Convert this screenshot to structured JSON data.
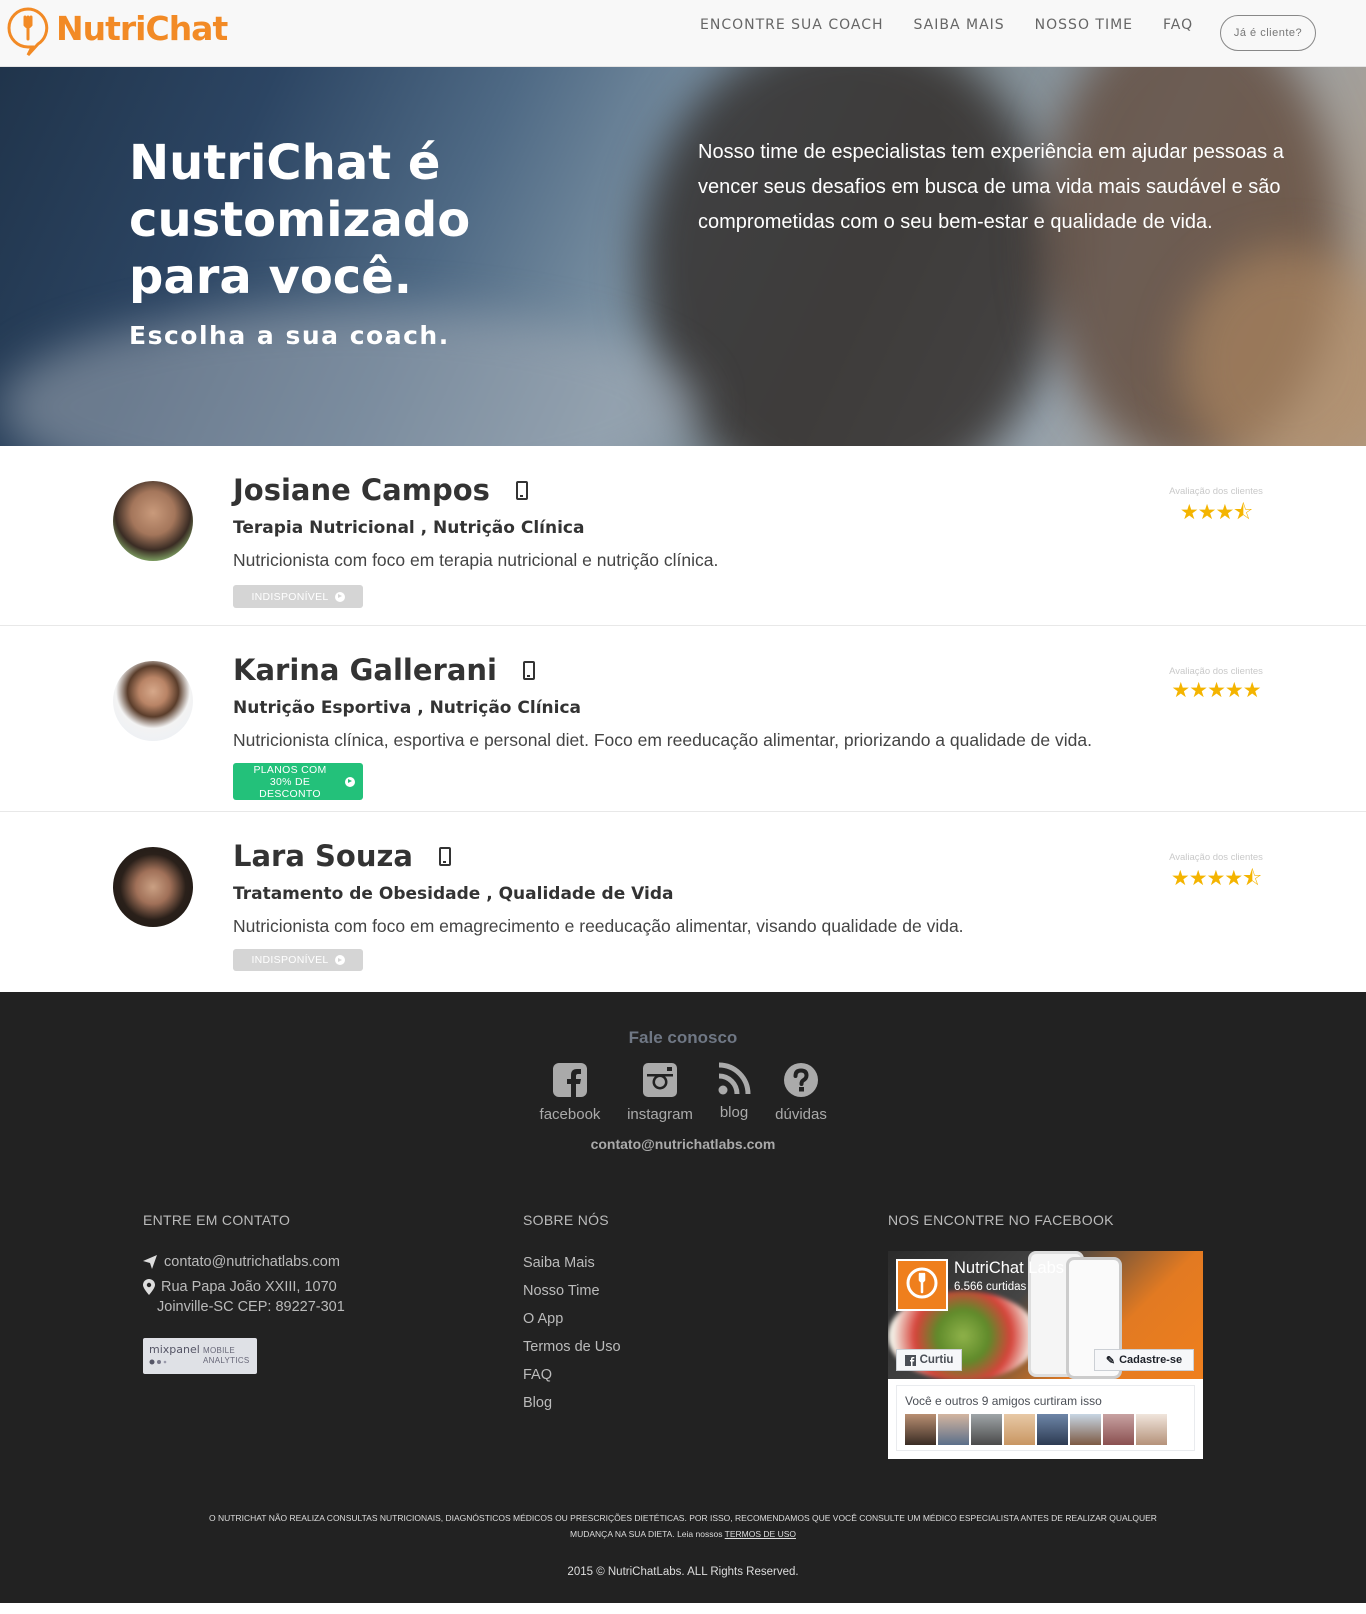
{
  "brand": {
    "name": "NutriChat",
    "color": "#f28a25"
  },
  "nav": {
    "items": [
      "ENCONTRE SUA COACH",
      "SAIBA MAIS",
      "NOSSO TIME",
      "FAQ"
    ],
    "client_button": "Já é cliente?"
  },
  "hero": {
    "title": "NutriChat é customizado para você.",
    "subtitle": "Escolha a sua coach.",
    "text": "Nosso time de especialistas tem experiência em ajudar pessoas a vencer seus desafios em busca de uma vida mais saudável e são comprometidas com o seu bem-estar e qualidade de vida."
  },
  "coaches": [
    {
      "name": "Josiane Campos",
      "specialties": "Terapia Nutricional , Nutrição Clínica",
      "description": "Nutricionista com foco em terapia nutricional e nutrição clínica.",
      "button": "INDISPONÍVEL",
      "button_color": "#d5d5d5",
      "rating_label": "Avaliação dos clientes",
      "stars": "★★★⯪",
      "rating": 3.5
    },
    {
      "name": "Karina Gallerani",
      "specialties": "Nutrição Esportiva , Nutrição Clínica",
      "description": "Nutricionista clínica, esportiva e personal diet. Foco em reeducação alimentar, priorizando a qualidade de vida.",
      "button": "PLANOS COM 30% DE DESCONTO",
      "button_color": "#23c17a",
      "rating_label": "Avaliação dos clientes",
      "stars": "★★★★★",
      "rating": 5
    },
    {
      "name": "Lara Souza",
      "specialties": "Tratamento de Obesidade , Qualidade de Vida",
      "description": "Nutricionista com foco em emagrecimento e reeducação alimentar, visando qualidade de vida.",
      "button": "INDISPONÍVEL",
      "button_color": "#d5d5d5",
      "rating_label": "Avaliação dos clientes",
      "stars": "★★★★⯪",
      "rating": 4.5
    }
  ],
  "footer": {
    "talk_title": "Fale conosco",
    "social": [
      {
        "label": "facebook",
        "icon": "facebook-icon"
      },
      {
        "label": "instagram",
        "icon": "instagram-icon"
      },
      {
        "label": "blog",
        "icon": "rss-icon"
      },
      {
        "label": "dúvidas",
        "icon": "question-icon"
      }
    ],
    "email": "contato@nutrichatlabs.com",
    "contact": {
      "title": "ENTRE EM CONTATO",
      "email": "contato@nutrichatlabs.com",
      "address_line1": "Rua Papa João XXIII, 1070",
      "address_line2": "Joinville-SC CEP: 89227-301",
      "mixpanel_name": "mixpanel",
      "mixpanel_tag1": "MOBILE",
      "mixpanel_tag2": "ANALYTICS"
    },
    "about": {
      "title": "SOBRE NÓS",
      "links": [
        "Saiba Mais",
        "Nosso Time",
        "O App",
        "Termos de Uso",
        "FAQ",
        "Blog"
      ]
    },
    "facebook": {
      "title": "NOS ENCONTRE NO FACEBOOK",
      "page_name": "NutriChat Labs",
      "likes": "6.566 curtidas",
      "liked_button": "Curtiu",
      "signup_button": "Cadastre-se",
      "friends_text": "Você e outros 9 amigos curtiram isso"
    },
    "disclaimer": "O NUTRICHAT NÃO REALIZA CONSULTAS NUTRICIONAIS, DIAGNÓSTICOS MÉDICOS OU PRESCRIÇÕES DIETÉTICAS. POR ISSO, RECOMENDAMOS QUE VOCÊ CONSULTE UM MÉDICO ESPECIALISTA ANTES DE REALIZAR QUALQUER MUDANÇA NA SUA DIETA. Leia nossos",
    "terms_link": "TERMOS DE USO",
    "copyright": "2015 © NutriChatLabs. ALL Rights Reserved."
  }
}
